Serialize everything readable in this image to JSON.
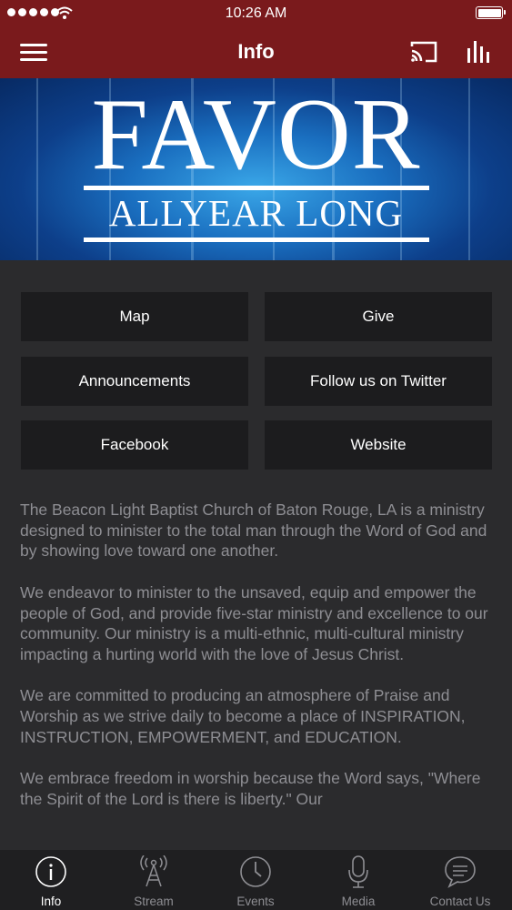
{
  "status_bar": {
    "time": "10:26 AM"
  },
  "app_bar": {
    "title": "Info"
  },
  "banner": {
    "line1": "FAVOR",
    "line2": "ALLYEAR LONG"
  },
  "buttons": {
    "map": "Map",
    "give": "Give",
    "announcements": "Announcements",
    "twitter": "Follow us on Twitter",
    "facebook": "Facebook",
    "website": "Website"
  },
  "description": {
    "p1": "The Beacon Light Baptist Church of Baton Rouge, LA is a ministry designed to minister to the total man through the Word of God and by showing love toward one another.",
    "p2": "We endeavor to minister to the unsaved, equip and empower the people of God, and provide five-star ministry and excellence to our community. Our ministry is a multi-ethnic, multi-cultural ministry impacting a hurting world with the love of Jesus Christ.",
    "p3": "We are committed to producing an atmosphere of Praise and Worship as we strive daily to become a place of INSPIRATION, INSTRUCTION, EMPOWERMENT, and EDUCATION.",
    "p4": "We embrace freedom in worship because the Word says, \"Where the Spirit of the Lord is there is liberty.\" Our"
  },
  "tabs": {
    "info": "Info",
    "stream": "Stream",
    "events": "Events",
    "media": "Media",
    "contact": "Contact Us"
  },
  "colors": {
    "header": "#7a1a1c",
    "background": "#2b2b2d",
    "tile": "#1c1c1e",
    "tabbar": "#1f1f21"
  },
  "icons": [
    "menu-icon",
    "cast-icon",
    "equalizer-icon",
    "info-icon",
    "antenna-icon",
    "clock-icon",
    "microphone-icon",
    "chat-icon"
  ]
}
